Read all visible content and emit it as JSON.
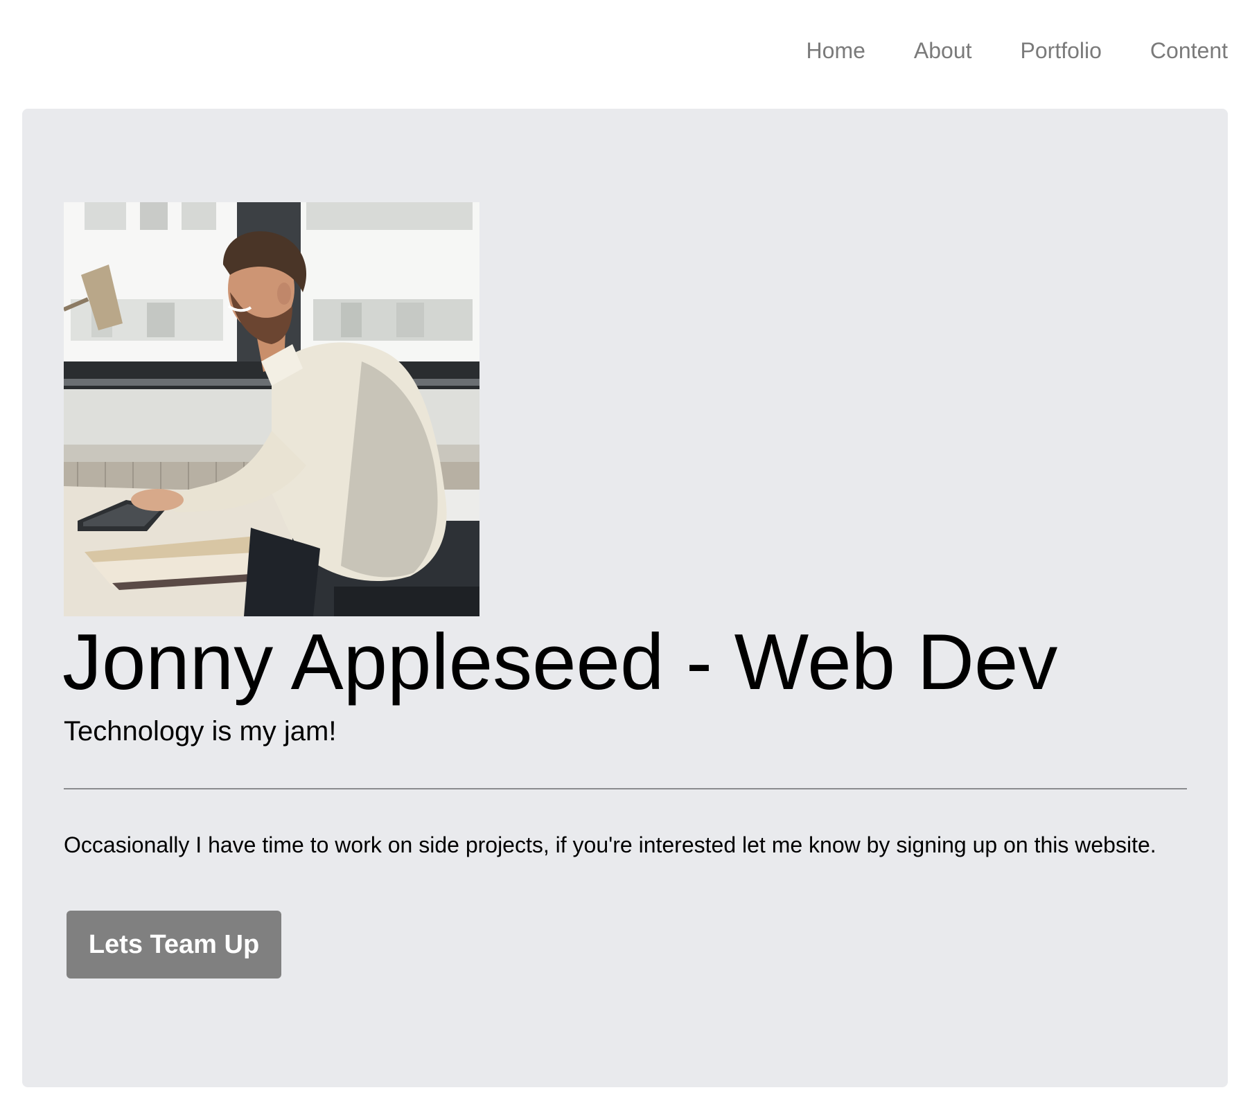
{
  "nav": {
    "items": [
      {
        "label": "Home"
      },
      {
        "label": "About"
      },
      {
        "label": "Portfolio"
      },
      {
        "label": "Content"
      }
    ]
  },
  "hero": {
    "title": "Jonny Appleseed - Web Dev",
    "lead": "Technology is my jam!",
    "text": "Occasionally I have time to work on side projects, if you're interested let me know by signing up on this website.",
    "button_label": "Lets Team Up"
  },
  "colors": {
    "nav_link": "#7a7a7a",
    "panel_background": "#e9eaed",
    "button_background": "#808080",
    "button_text": "#ffffff",
    "divider": "#8a8b8e"
  }
}
